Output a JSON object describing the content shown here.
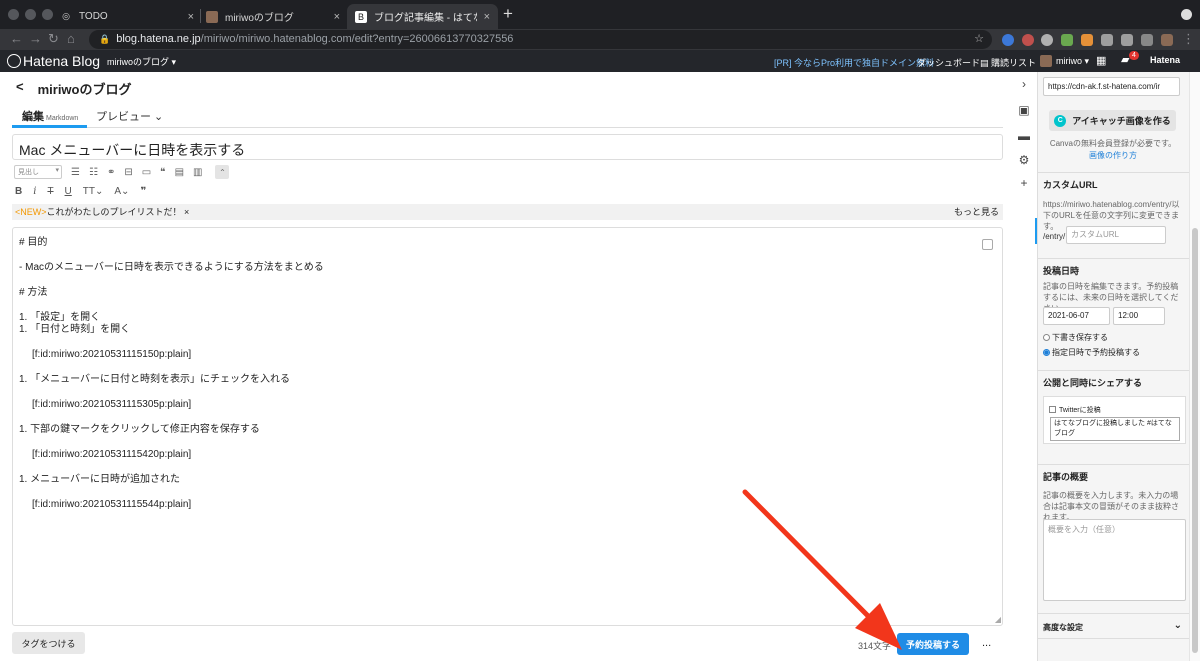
{
  "browser": {
    "tabs": [
      {
        "title": "TODO",
        "close": "×"
      },
      {
        "title": "miriwoのブログ",
        "close": "×"
      },
      {
        "title": "ブログ記事編集 - はてなブログ",
        "close": "×"
      }
    ],
    "new_tab": "+",
    "url_host": "blog.hatena.ne.jp",
    "url_path": "/miriwo/miriwo.hatenablog.com/edit?entry=26006613770327556"
  },
  "hatena_header": {
    "logo": "Hatena Blog",
    "blog_menu": "miriwoのブログ ▾",
    "promo": "[PR] 今ならPro利用で独自ドメイン無料",
    "dashboard": "ダッシュボード",
    "subscriptions": "購読リスト",
    "user": "miriwo ▾",
    "notification_count": "4",
    "hatena": "Hatena"
  },
  "editor": {
    "blog_name": "miriwoのブログ",
    "back": "<",
    "tab_edit": "編集",
    "tab_edit_mode": "Markdown",
    "tab_preview": "プレビュー ⌄",
    "title": "Mac メニューバーに日時を表示する",
    "heading_select": "見出し",
    "news_tag": "<NEW>",
    "news_text": "これがわたしのプレイリストだ！",
    "news_close": "×",
    "news_more": "もっと見る",
    "lines": [
      "# 目的",
      "",
      "- Macのメニューバーに日時を表示できるようにする方法をまとめる",
      "",
      "# 方法",
      "",
      "1. 「設定」を開く",
      "1. 「日付と時刻」を開く",
      "",
      "[f:id:miriwo:20210531115150p:plain]",
      "",
      "1. 「メニューバーに日付と時刻を表示」にチェックを入れる",
      "",
      "[f:id:miriwo:20210531115305p:plain]",
      "",
      "1. 下部の鍵マークをクリックして修正内容を保存する",
      "",
      "[f:id:miriwo:20210531115420p:plain]",
      "",
      "1. メニューバーに日時が追加された",
      "",
      "[f:id:miriwo:20210531115544p:plain]"
    ],
    "tag_button": "タグをつける",
    "char_count": "314文字",
    "publish_button": "予約投稿する",
    "more_button": "..."
  },
  "sidebar": {
    "image_url": "https://cdn-ak.f.st-hatena.com/ir",
    "eyecatch_button": "アイキャッチ画像を作る",
    "canva_note": "Canvaの無料会員登録が必要です。",
    "canva_link": "画像の作り方",
    "custom_url_title": "カスタムURL",
    "custom_url_desc": "https://miriwo.hatenablog.com/entry/以下のURLを任意の文字列に変更できます。",
    "custom_url_prefix": "/entry/",
    "custom_url_placeholder": "カスタムURL",
    "post_date_title": "投稿日時",
    "post_date_desc": "記事の日時を編集できます。予約投稿するには、未来の日時を選択してください。",
    "date": "2021-06-07",
    "time": "12:00",
    "radio_draft": "下書き保存する",
    "radio_schedule": "指定日時で予約投稿する",
    "share_title": "公開と同時にシェアする",
    "twitter_label": "Twitterに投稿",
    "tweet_text": "はてなブログに投稿しました #はてなブログ",
    "summary_title": "記事の概要",
    "summary_desc": "記事の概要を入力します。未入力の場合は記事本文の冒頭がそのまま抜粋されます。",
    "summary_placeholder": "概要を入力（任意）",
    "advanced": "高度な設定"
  },
  "colors": {
    "accent": "#1d9bf0",
    "publish": "#1f8ce6",
    "annotation_arrow": "#f2361b",
    "news_tag": "#f39800"
  }
}
